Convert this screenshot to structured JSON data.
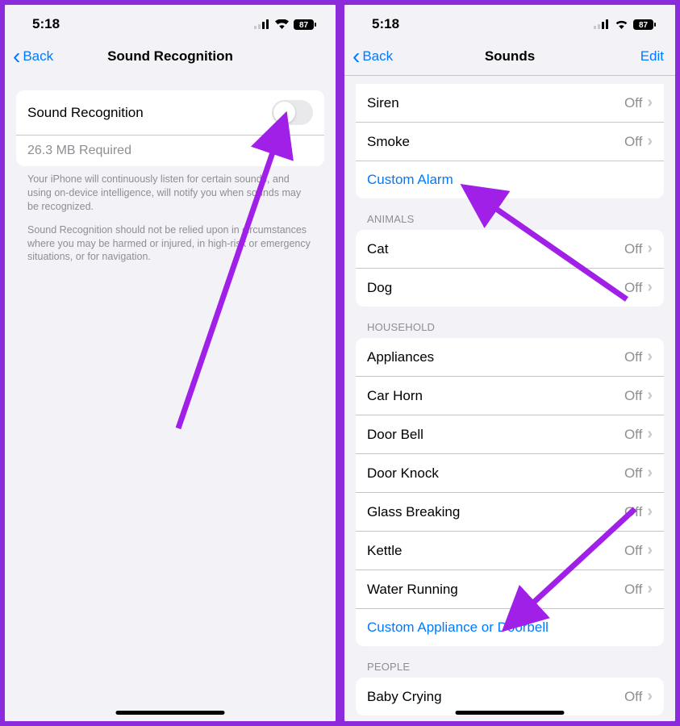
{
  "status": {
    "time": "5:18",
    "battery": "87"
  },
  "left": {
    "nav": {
      "back": "Back",
      "title": "Sound Recognition"
    },
    "toggle": {
      "label": "Sound Recognition"
    },
    "required": "26.3 MB Required",
    "footer1": "Your iPhone will continuously listen for certain sounds, and using on-device intelligence, will notify you when sounds may be recognized.",
    "footer2": "Sound Recognition should not be relied upon in circumstances where you may be harmed or injured, in high-risk or emergency situations, or for navigation."
  },
  "right": {
    "nav": {
      "back": "Back",
      "title": "Sounds",
      "edit": "Edit"
    },
    "off": "Off",
    "group0": {
      "items": [
        {
          "label": "Siren",
          "value": "Off"
        },
        {
          "label": "Smoke",
          "value": "Off"
        }
      ],
      "custom": "Custom Alarm"
    },
    "group1": {
      "header": "ANIMALS",
      "items": [
        {
          "label": "Cat",
          "value": "Off"
        },
        {
          "label": "Dog",
          "value": "Off"
        }
      ]
    },
    "group2": {
      "header": "HOUSEHOLD",
      "items": [
        {
          "label": "Appliances",
          "value": "Off"
        },
        {
          "label": "Car Horn",
          "value": "Off"
        },
        {
          "label": "Door Bell",
          "value": "Off"
        },
        {
          "label": "Door Knock",
          "value": "Off"
        },
        {
          "label": "Glass Breaking",
          "value": "Off"
        },
        {
          "label": "Kettle",
          "value": "Off"
        },
        {
          "label": "Water Running",
          "value": "Off"
        }
      ],
      "custom": "Custom Appliance or Doorbell"
    },
    "group3": {
      "header": "PEOPLE",
      "items": [
        {
          "label": "Baby Crying",
          "value": "Off"
        }
      ]
    }
  }
}
